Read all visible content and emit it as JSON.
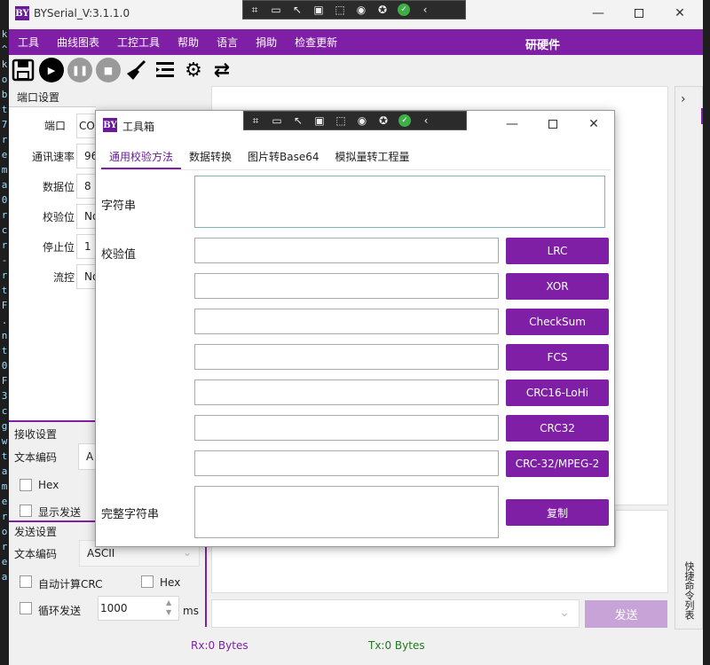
{
  "colors": {
    "accent": "#7e1fa6",
    "rx": "#7e1fa6",
    "tx": "#1a7d1a"
  },
  "left_strip_chars": [
    "k",
    "^",
    "k",
    "o",
    "b",
    "t",
    "7",
    "r",
    "e",
    "m",
    "a",
    "0",
    "r",
    "c",
    "r",
    "-",
    "r",
    "t",
    "F",
    ".",
    "n",
    "t",
    "0",
    "F",
    "3",
    "c",
    "g",
    "w",
    "t",
    "a",
    "m",
    "e",
    "r",
    "o",
    "r",
    "e",
    "a"
  ],
  "app": {
    "logo": "BY",
    "title": "BYSerial_V:3.1.1.0"
  },
  "menu": {
    "items": [
      "工具",
      "曲线图表",
      "工控工具",
      "帮助",
      "语言",
      "捐助",
      "检查更新"
    ],
    "brand": "研硬件"
  },
  "toolbar": {
    "icons": [
      "save-icon",
      "play-icon",
      "pause-icon",
      "stop-icon",
      "broom-icon",
      "list-icon",
      "gear-icon",
      "refresh-icon"
    ]
  },
  "port_settings": {
    "title": "端口设置",
    "fields": [
      {
        "label": "端口",
        "value": "CO"
      },
      {
        "label": "通讯速率",
        "value": "96"
      },
      {
        "label": "数据位",
        "value": "8"
      },
      {
        "label": "校验位",
        "value": "No"
      },
      {
        "label": "停止位",
        "value": "1"
      },
      {
        "label": "流控",
        "value": "No"
      }
    ]
  },
  "receive_settings": {
    "title": "接收设置",
    "encoding_label": "文本编码",
    "encoding_value": "A",
    "hex_label": "Hex",
    "show_send_label": "显示发送"
  },
  "send_settings": {
    "title": "发送设置",
    "encoding_label": "文本编码",
    "encoding_value": "ASCII",
    "auto_crc_label": "自动计算CRC",
    "hex_label": "Hex",
    "loop_label": "循环发送",
    "interval_value": "1000",
    "interval_unit": "ms"
  },
  "send_button": "发送",
  "shortcut_panel": "快捷命令列表",
  "status": {
    "rx": "Rx:0 Bytes",
    "tx": "Tx:0 Bytes"
  },
  "dialog": {
    "logo": "BY",
    "title": "工具箱",
    "tabs": [
      "通用校验方法",
      "数据转换",
      "图片转Base64",
      "模拟量转工程量"
    ],
    "active_tab": 0,
    "string_label": "字符串",
    "checksum_label": "校验值",
    "full_string_label": "完整字符串",
    "buttons": [
      "LRC",
      "XOR",
      "CheckSum",
      "FCS",
      "CRC16-LoHi",
      "CRC32",
      "CRC-32/MPEG-2"
    ],
    "copy_button": "复制"
  }
}
